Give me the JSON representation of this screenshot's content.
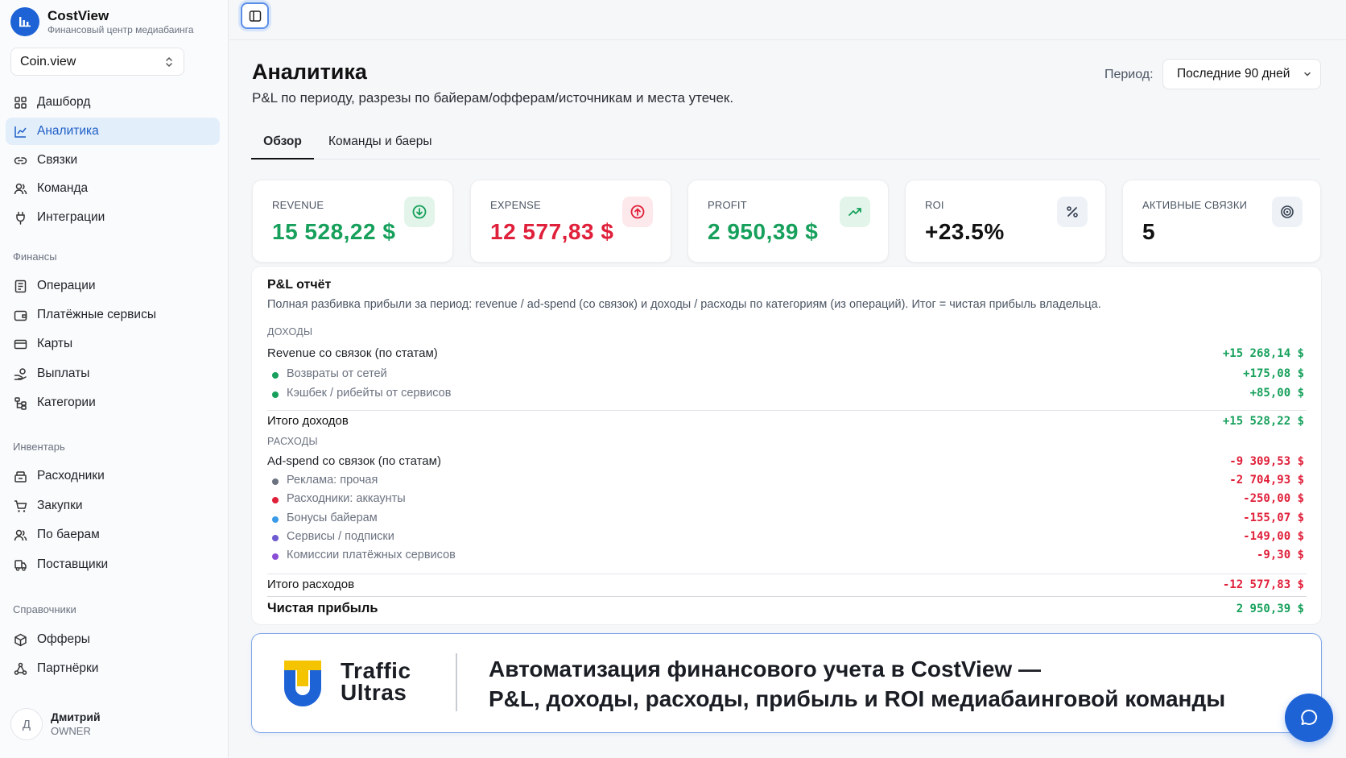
{
  "brand": {
    "name": "CostView",
    "subtitle": "Финансовый центр медиабаинга"
  },
  "workspace": {
    "selected": "Coin.view"
  },
  "sidebar": {
    "main": [
      {
        "label": "Дашборд",
        "icon": "grid-icon",
        "active": false
      },
      {
        "label": "Аналитика",
        "icon": "chart-line-icon",
        "active": true
      },
      {
        "label": "Связки",
        "icon": "link-icon",
        "active": false
      },
      {
        "label": "Команда",
        "icon": "users-icon",
        "active": false
      },
      {
        "label": "Интеграции",
        "icon": "plug-icon",
        "active": false
      }
    ],
    "finance_label": "Финансы",
    "finance": [
      {
        "label": "Операции",
        "icon": "ledger-icon"
      },
      {
        "label": "Платёжные сервисы",
        "icon": "wallet-icon"
      },
      {
        "label": "Карты",
        "icon": "credit-card-icon"
      },
      {
        "label": "Выплаты",
        "icon": "payout-icon"
      },
      {
        "label": "Категории",
        "icon": "tree-icon"
      }
    ],
    "inventory_label": "Инвентарь",
    "inventory": [
      {
        "label": "Расходники",
        "icon": "box-icon"
      },
      {
        "label": "Закупки",
        "icon": "cart-icon"
      },
      {
        "label": "По баерам",
        "icon": "users-icon"
      },
      {
        "label": "Поставщики",
        "icon": "truck-icon"
      }
    ],
    "reference_label": "Справочники",
    "reference": [
      {
        "label": "Офферы",
        "icon": "package-icon"
      },
      {
        "label": "Партнёрки",
        "icon": "network-icon"
      }
    ]
  },
  "user": {
    "initial": "Д",
    "name": "Дмитрий",
    "role": "OWNER"
  },
  "header": {
    "title": "Аналитика",
    "subtitle": "P&L по периоду, разрезы по байерам/офферам/источникам и места утечек.",
    "period_label": "Период:",
    "period_value": "Последние 90 дней"
  },
  "tabs": [
    {
      "label": "Обзор",
      "active": true
    },
    {
      "label": "Команды и баеры",
      "active": false
    }
  ],
  "kpis": [
    {
      "label": "REVENUE",
      "value": "15 528,22 $",
      "color": "#16a05b",
      "icon": "arrow-down-circle-icon"
    },
    {
      "label": "EXPENSE",
      "value": "12 577,83 $",
      "color": "#e0203a",
      "icon": "arrow-up-circle-icon"
    },
    {
      "label": "PROFIT",
      "value": "2 950,39 $",
      "color": "#16a05b",
      "icon": "trending-up-icon"
    },
    {
      "label": "ROI",
      "value": "+23.5%",
      "color": "#111111",
      "icon": "percent-icon"
    },
    {
      "label": "АКТИВНЫЕ СВЯЗКИ",
      "value": "5",
      "color": "#111111",
      "icon": "target-icon"
    }
  ],
  "pl": {
    "title": "P&L отчёт",
    "description": "Полная разбивка прибыли за период: revenue / ad-spend (со связок) и доходы / расходы по категориям (из операций). Итог = чистая прибыль владельца.",
    "income_label": "ДОХОДЫ",
    "income_main": {
      "label": "Revenue со связок (по статам)",
      "value": "+15 268,14 $"
    },
    "income_items": [
      {
        "label": "Возвраты от сетей",
        "value": "+175,08 $",
        "dot": "#16a05b"
      },
      {
        "label": "Кэшбек / рибейты от сервисов",
        "value": "+85,00 $",
        "dot": "#16a05b"
      }
    ],
    "income_total": {
      "label": "Итого доходов",
      "value": "+15 528,22 $"
    },
    "expense_label": "РАСХОДЫ",
    "expense_main": {
      "label": "Ad-spend со связок (по статам)",
      "value": "-9 309,53 $"
    },
    "expense_items": [
      {
        "label": "Реклама: прочая",
        "value": "-2 704,93 $",
        "dot": "#6b7280"
      },
      {
        "label": "Расходники: аккаунты",
        "value": "-250,00 $",
        "dot": "#e0203a"
      },
      {
        "label": "Бонусы байерам",
        "value": "-155,07 $",
        "dot": "#3b9be8"
      },
      {
        "label": "Сервисы / подписки",
        "value": "-149,00 $",
        "dot": "#6d5bd0"
      },
      {
        "label": "Комиссии платёжных сервисов",
        "value": "-9,30 $",
        "dot": "#8b4fd6"
      }
    ],
    "expense_total": {
      "label": "Итого расходов",
      "value": "-12 577,83 $"
    },
    "net": {
      "label": "Чистая прибыль",
      "value": "2 950,39 $"
    }
  },
  "banner": {
    "brand_line1": "Traffic",
    "brand_line2": "Ultras",
    "text_line1": "Автоматизация финансового учета в CostView —",
    "text_line2": "P&L, доходы, расходы, прибыль и ROI медиабаинговой команды"
  }
}
